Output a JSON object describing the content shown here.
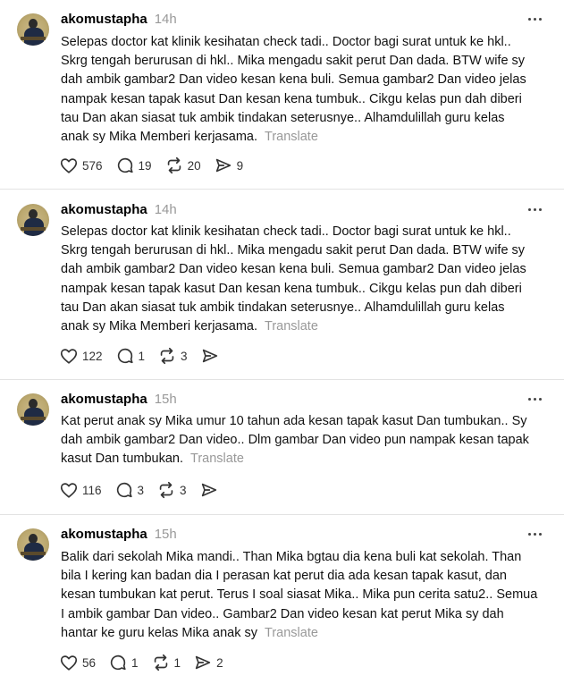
{
  "posts": [
    {
      "username": "akomustapha",
      "time": "14h",
      "text": "Selepas doctor kat klinik kesihatan check tadi.. Doctor bagi surat untuk ke hkl..\nSkrg tengah berurusan di hkl.. Mika mengadu sakit perut Dan dada. BTW wife sy\ndah ambik gambar2 Dan video kesan kena buli. Semua gambar2 Dan video jelas\nnampak kesan tapak kasut Dan kesan kena tumbuk.. Cikgu kelas pun dah diberi\ntau Dan akan siasat tuk ambik tindakan seterusnye.. Alhamdulillah guru kelas\nanak sy Mika Memberi kerjasama.",
      "translate": "Translate",
      "likes": "576",
      "replies": "19",
      "reposts": "20",
      "shares": "9"
    },
    {
      "username": "akomustapha",
      "time": "14h",
      "text": "Selepas doctor kat klinik kesihatan check tadi.. Doctor bagi surat untuk ke hkl..\nSkrg tengah berurusan di hkl.. Mika mengadu sakit perut Dan dada. BTW wife sy\ndah ambik gambar2 Dan video kesan kena buli. Semua gambar2 Dan video jelas\nnampak kesan tapak kasut Dan kesan kena tumbuk.. Cikgu kelas pun dah diberi\ntau Dan akan siasat tuk ambik tindakan seterusnye.. Alhamdulillah guru kelas\nanak sy Mika Memberi kerjasama.",
      "translate": "Translate",
      "likes": "122",
      "replies": "1",
      "reposts": "3",
      "shares": ""
    },
    {
      "username": "akomustapha",
      "time": "15h",
      "text": "Kat perut anak sy Mika umur 10 tahun ada kesan tapak kasut Dan tumbukan.. Sy\ndah ambik gambar2 Dan video.. Dlm gambar Dan video pun nampak kesan tapak\nkasut Dan tumbukan.",
      "translate": "Translate",
      "likes": "116",
      "replies": "3",
      "reposts": "3",
      "shares": ""
    },
    {
      "username": "akomustapha",
      "time": "15h",
      "text": "Balik dari sekolah Mika mandi.. Than Mika bgtau dia kena buli kat sekolah. Than\nbila I kering kan badan dia I perasan kat perut dia ada kesan tapak kasut, dan\nkesan tumbukan kat perut. Terus I soal siasat Mika.. Mika pun cerita satu2.. Semua\nI ambik gambar Dan video.. Gambar2 Dan video kesan kat perut Mika sy dah\nhantar ke guru kelas Mika anak sy",
      "translate": "Translate",
      "likes": "56",
      "replies": "1",
      "reposts": "1",
      "shares": "2"
    }
  ]
}
